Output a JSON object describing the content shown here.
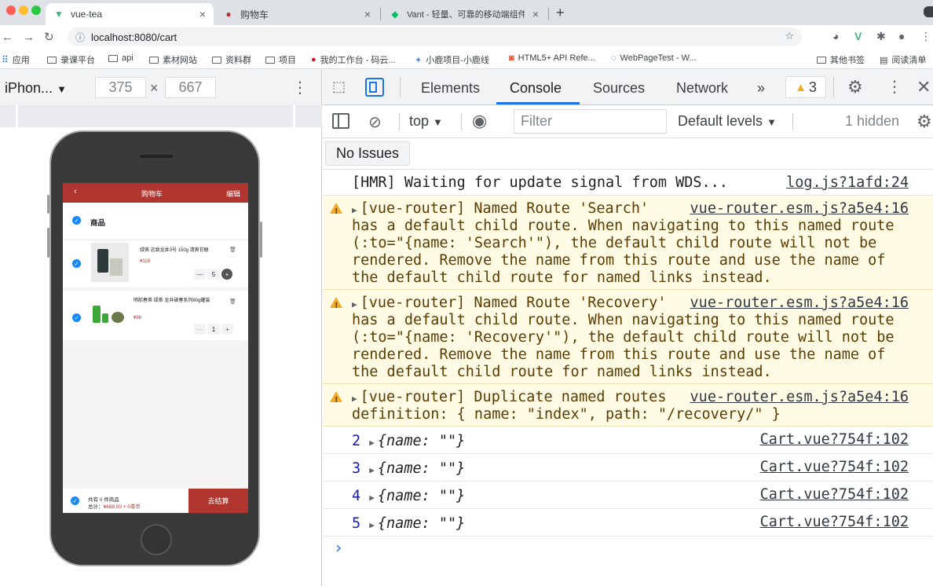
{
  "browser": {
    "tabs": [
      {
        "title": "vue-tea",
        "icon": "vue-logo-icon",
        "active": true
      },
      {
        "title": "购物车",
        "icon": "cart-favicon-icon",
        "active": false
      },
      {
        "title": "Vant - 轻量、可靠的移动端组件",
        "icon": "vant-favicon-icon",
        "active": false
      }
    ],
    "new_tab": "+",
    "url": "localhost:8080/cart",
    "bookmarks": [
      "应用",
      "录课平台",
      "api",
      "素材网站",
      "资料群",
      "项目",
      "我的工作台 - 码云...",
      "小鹿项目-小鹿线",
      "HTML5+ API Refe...",
      "WebPageTest - W...",
      "其他书签",
      "阅读清单"
    ]
  },
  "device_toolbar": {
    "device": "iPhon...",
    "width": "375",
    "times": "×",
    "height": "667"
  },
  "app": {
    "header": {
      "back": "‹",
      "title": "购物车",
      "edit": "编辑"
    },
    "section_title": "商品",
    "items": [
      {
        "name": "绿茶 远致龙井3号 150g 清爽甘醇",
        "price": "¥118",
        "qty": "5"
      },
      {
        "name": "明前春茶 绿茶 龙井破春系列80g罐装",
        "price": "¥98",
        "qty": "1"
      }
    ],
    "submit": {
      "count_prefix": "共有",
      "count": "6",
      "count_suffix": "件商品",
      "total_label": "总计：",
      "total": "¥688.00 + 0茶币",
      "checkout": "去结算"
    }
  },
  "devtools": {
    "tabs": [
      "Elements",
      "Console",
      "Sources",
      "Network"
    ],
    "active_tab": "Console",
    "more": "»",
    "warning_count": "3",
    "context": "top",
    "filter_placeholder": "Filter",
    "levels": "Default levels",
    "hidden": "1 hidden",
    "no_issues": "No Issues",
    "messages": [
      {
        "type": "info",
        "lines": [
          "[HMR] Waiting for update signal from WDS..."
        ],
        "source": "log.js?1afd:24"
      },
      {
        "type": "warn",
        "lines": [
          "[vue-router] Named Route 'Search'",
          "has a default child route. When navigating to this named route",
          "(:to=\"{name: 'Search'\"), the default child route will not be",
          "rendered. Remove the name from this route and use the name of",
          "the default child route for named links instead."
        ],
        "source": "vue-router.esm.js?a5e4:16"
      },
      {
        "type": "warn",
        "lines": [
          "[vue-router] Named Route 'Recovery'",
          "has a default child route. When navigating to this named route",
          "(:to=\"{name: 'Recovery'\"), the default child route will not be",
          "rendered. Remove the name from this route and use the name of",
          "the default child route for named links instead."
        ],
        "source": "vue-router.esm.js?a5e4:16"
      },
      {
        "type": "warn",
        "lines": [
          "[vue-router] Duplicate named routes",
          "definition: { name: \"index\", path: \"/recovery/\" }"
        ],
        "source": "vue-router.esm.js?a5e4:16"
      }
    ],
    "logs": [
      {
        "num": "2",
        "obj": "{name: \"\"}",
        "source": "Cart.vue?754f:102"
      },
      {
        "num": "3",
        "obj": "{name: \"\"}",
        "source": "Cart.vue?754f:102"
      },
      {
        "num": "4",
        "obj": "{name: \"\"}",
        "source": "Cart.vue?754f:102"
      },
      {
        "num": "5",
        "obj": "{name: \"\"}",
        "source": "Cart.vue?754f:102"
      }
    ],
    "prompt": "›"
  },
  "colors": {
    "accent": "#b0352f",
    "check": "#1989fa",
    "devtools_blue": "#1a73e8",
    "warn_bg": "#fffbe5"
  }
}
